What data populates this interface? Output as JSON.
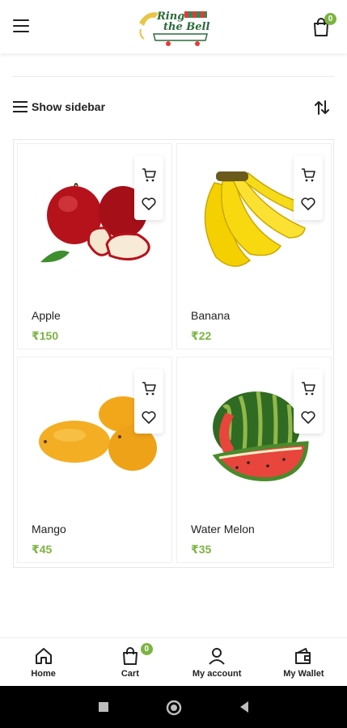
{
  "header": {
    "logo_line1": "Ring",
    "logo_line2": "the Bell",
    "cart_count": "0"
  },
  "toolbar": {
    "sidebar_label": "Show sidebar"
  },
  "products": [
    {
      "name": "Apple",
      "price": "₹150"
    },
    {
      "name": "Banana",
      "price": "₹22"
    },
    {
      "name": "Mango",
      "price": "₹45"
    },
    {
      "name": "Water Melon",
      "price": "₹35"
    }
  ],
  "bottom_nav": {
    "home": "Home",
    "cart": "Cart",
    "cart_count": "0",
    "account": "My account",
    "wallet": "My Wallet"
  },
  "colors": {
    "accent": "#7cb342",
    "text": "#222222"
  }
}
